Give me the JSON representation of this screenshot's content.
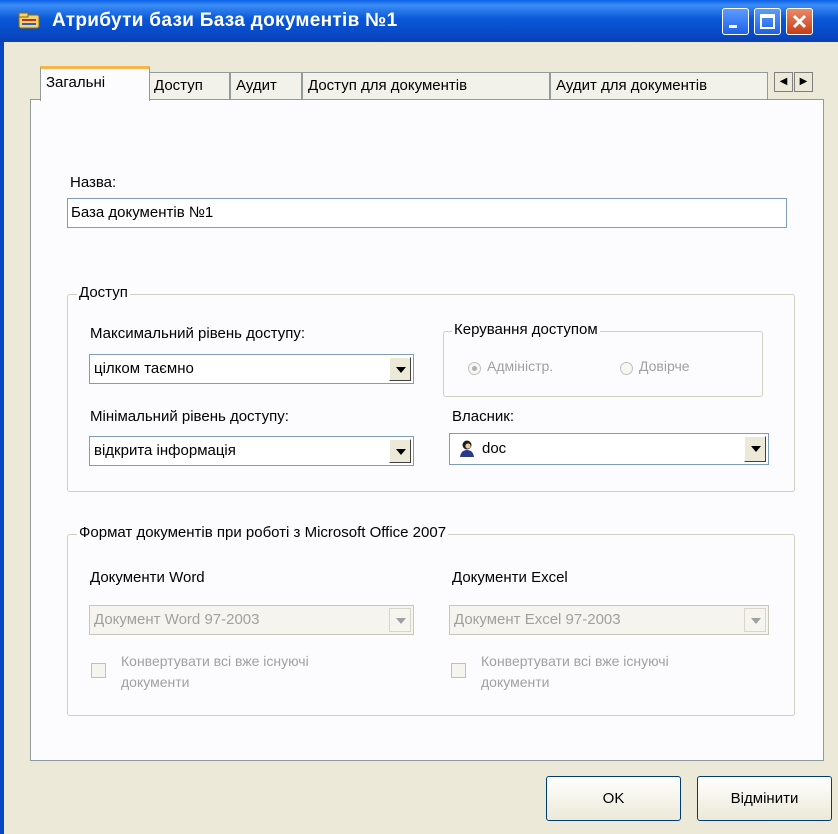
{
  "window": {
    "title": "Атрибути бази База документів №1"
  },
  "tabs": [
    {
      "label": "Загальні",
      "active": true
    },
    {
      "label": "Доступ"
    },
    {
      "label": "Аудит"
    },
    {
      "label": "Доступ для документів"
    },
    {
      "label": "Аудит для документів"
    }
  ],
  "general": {
    "name_label": "Назва:",
    "name_value": "База документів №1"
  },
  "access": {
    "group_title": "Доступ",
    "max_level_label": "Максимальний рівень доступу:",
    "max_level_value": "цілком таємно",
    "min_level_label": "Мінімальний рівень доступу:",
    "min_level_value": "відкрита інформація",
    "control_title": "Керування доступом",
    "control_options": [
      {
        "label": "Адміністр.",
        "selected": true,
        "enabled": false
      },
      {
        "label": "Довірче",
        "selected": false,
        "enabled": false
      }
    ],
    "owner_label": "Власник:",
    "owner_value": "doc",
    "owner_icon": "user-icon"
  },
  "format": {
    "group_title": "Формат документів при роботі з Microsoft Office 2007",
    "word_label": "Документи Word",
    "word_value": "Документ Word 97-2003",
    "word_convert_line1": "Конвертувати всі вже існуючі",
    "word_convert_line2": "документи",
    "excel_label": "Документи Excel",
    "excel_value": "Документ Excel 97-2003",
    "excel_convert_line1": "Конвертувати всі вже існуючі",
    "excel_convert_line2": "документи"
  },
  "buttons": {
    "ok": "OK",
    "cancel": "Відмінити"
  },
  "colors": {
    "titlebar": "#0a58d8",
    "tab_highlight": "#f7b64a",
    "face": "#ece9d8"
  }
}
